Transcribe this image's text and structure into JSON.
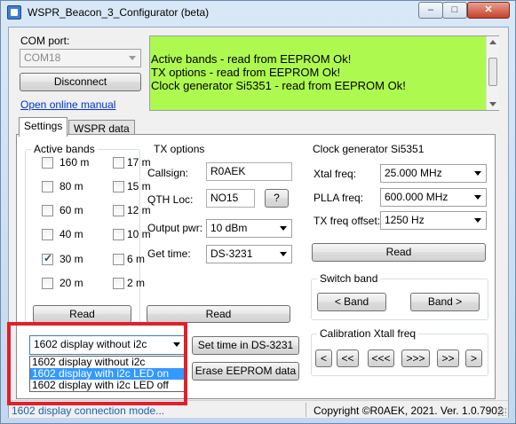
{
  "window": {
    "title": "WSPR_Beacon_3_Configurator (beta)",
    "controls": {
      "minimize": "–",
      "maximize": "□",
      "close": "✕"
    }
  },
  "com": {
    "label": "COM port:",
    "value": "COM18",
    "disconnect_label": "Disconnect",
    "manual_link": "Open online manual"
  },
  "log": {
    "lines": [
      "Active bands - read from EEPROM Ok!",
      "TX options - read from EEPROM Ok!",
      "Clock generator Si5351 - read from EEPROM Ok!"
    ]
  },
  "tabs": [
    {
      "label": "Settings",
      "active": true
    },
    {
      "label": "WSPR data",
      "active": false
    }
  ],
  "active_bands": {
    "title": "Active bands",
    "bands": [
      {
        "label": "160 m",
        "checked": false
      },
      {
        "label": "17 m",
        "checked": false
      },
      {
        "label": "80 m",
        "checked": false
      },
      {
        "label": "15 m",
        "checked": false
      },
      {
        "label": "60 m",
        "checked": false
      },
      {
        "label": "12 m",
        "checked": false
      },
      {
        "label": "40 m",
        "checked": false
      },
      {
        "label": "10 m",
        "checked": false
      },
      {
        "label": "30 m",
        "checked": true
      },
      {
        "label": "6 m",
        "checked": false
      },
      {
        "label": "20 m",
        "checked": false
      },
      {
        "label": "2 m",
        "checked": false
      }
    ],
    "read_label": "Read"
  },
  "tx_options": {
    "title": "TX options",
    "callsign_label": "Callsign:",
    "callsign_value": "R0AEK",
    "qth_label": "QTH Loc:",
    "qth_value": "NO15",
    "qth_help": "?",
    "power_label": "Output pwr:",
    "power_value": "10 dBm",
    "time_label": "Get time:",
    "time_value": "DS-3231",
    "read_label": "Read"
  },
  "clock": {
    "title": "Clock generator Si5351",
    "xtal_label": "Xtal freq:",
    "xtal_value": "25.000 MHz",
    "plla_label": "PLLA freq:",
    "plla_value": "600.000 MHz",
    "offset_label": "TX freq offset:",
    "offset_value": "1250 Hz",
    "read_label": "Read"
  },
  "switch_band": {
    "title": "Switch band",
    "prev_label": "< Band",
    "next_label": "Band >"
  },
  "calibration": {
    "title": "Calibration Xtall freq",
    "buttons": [
      "<",
      "<<",
      "<<<",
      ">>>",
      ">>",
      ">"
    ]
  },
  "display_mode": {
    "value": "1602 display without i2c",
    "options": [
      {
        "label": "1602 display without i2c",
        "selected": false
      },
      {
        "label": "1602 display with i2c LED on",
        "selected": true
      },
      {
        "label": "1602 display with i2c LED off",
        "selected": false
      }
    ]
  },
  "actions": {
    "set_time_label": "Set time in DS-3231",
    "erase_label": "Erase EEPROM data"
  },
  "status": {
    "left": "1602 display connection mode...",
    "right": "Copyright ©R0AEK, 2021. Ver. 1.0.7902"
  },
  "colors": {
    "log_background": "#aef94f",
    "highlight": "#e0202a",
    "selection": "#3399ff",
    "link": "#0033cc"
  }
}
